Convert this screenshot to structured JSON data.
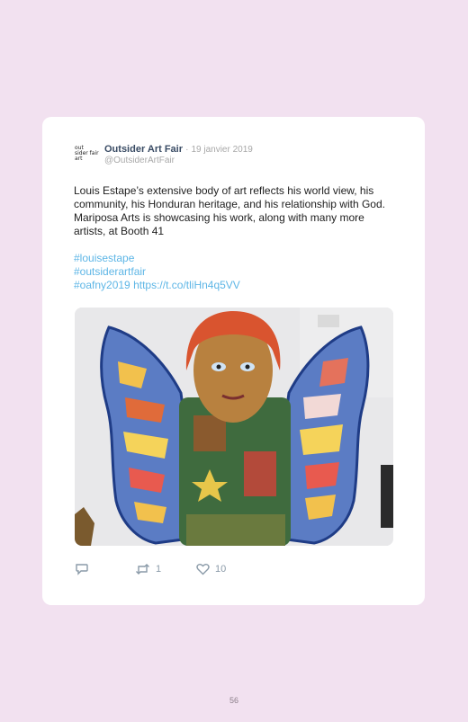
{
  "tweet": {
    "avatar_text": [
      "out",
      "sider fair",
      "art"
    ],
    "author_name": "Outsider Art Fair",
    "separator": "·",
    "date": "19 janvier 2019",
    "handle": "@OutsiderArtFair",
    "text": "Louis Estape’s extensive body of art reflects his world view, his community, his Honduran heritage, and his relationship with God. Mariposa Arts is showcasing his work, along with many more artists, at Booth 41",
    "hashtags": [
      "#louisestape",
      "#outsiderartfair",
      "#oafny2019"
    ],
    "link": "https://t.co/tliHn4q5VV",
    "retweet_count": "1",
    "like_count": "10"
  },
  "page_number": "56",
  "icons": {
    "reply": "reply-icon",
    "retweet": "retweet-icon",
    "like": "heart-icon"
  },
  "colors": {
    "background": "#f2e1f0",
    "card": "#ffffff",
    "author_name": "#394b64",
    "hashtag": "#5eb6e6",
    "meta": "#a8a8a8"
  }
}
